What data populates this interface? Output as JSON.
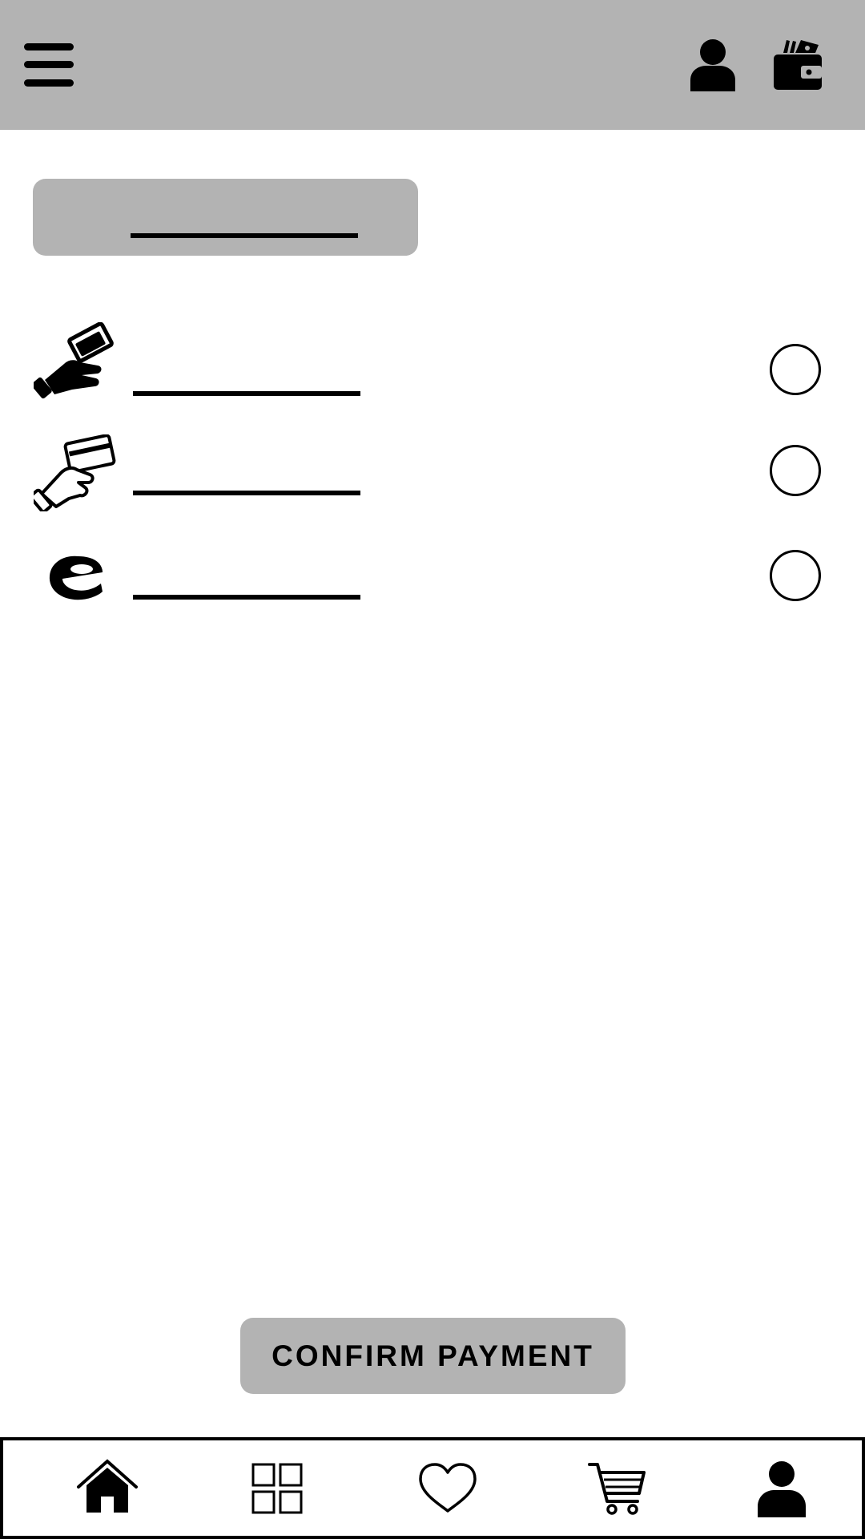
{
  "header": {
    "menu_icon": "hamburger-menu-icon",
    "profile_icon": "user-icon",
    "wallet_icon": "wallet-icon",
    "background": "#b3b3b3"
  },
  "section": {
    "title": ""
  },
  "payment_methods": [
    {
      "icon": "cash-hand-icon",
      "label": "",
      "selected": false
    },
    {
      "icon": "card-hand-icon",
      "label": "",
      "selected": false
    },
    {
      "icon": "e-wallet-logo-icon",
      "label": "",
      "selected": false
    }
  ],
  "actions": {
    "confirm_label": "CONFIRM PAYMENT"
  },
  "bottom_nav": [
    {
      "icon": "home-icon"
    },
    {
      "icon": "grid-icon"
    },
    {
      "icon": "heart-icon"
    },
    {
      "icon": "cart-icon"
    },
    {
      "icon": "profile-icon"
    }
  ]
}
